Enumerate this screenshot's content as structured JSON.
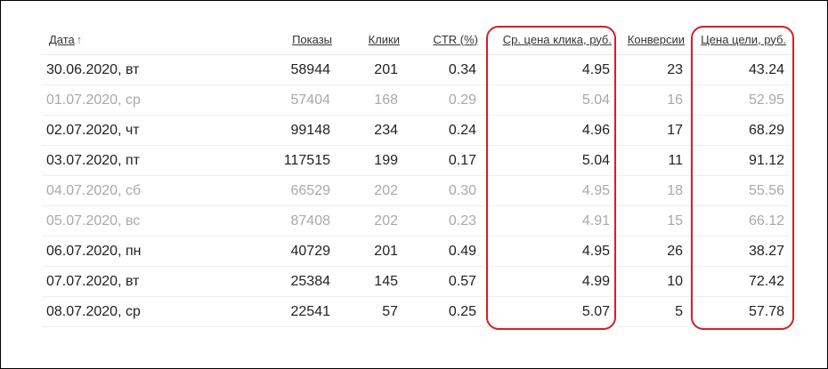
{
  "columns": [
    {
      "key": "date",
      "label": "Дата",
      "sort_arrow": "↑"
    },
    {
      "key": "impressions",
      "label": "Показы"
    },
    {
      "key": "clicks",
      "label": "Клики"
    },
    {
      "key": "ctr",
      "label": "CTR (%)"
    },
    {
      "key": "cpc",
      "label": "Ср. цена клика, руб."
    },
    {
      "key": "conversions",
      "label": "Конверсии"
    },
    {
      "key": "goal_cost",
      "label": "Цена цели, руб."
    }
  ],
  "rows": [
    {
      "date": "30.06.2020, вт",
      "impressions": "58944",
      "clicks": "201",
      "ctr": "0.34",
      "cpc": "4.95",
      "conversions": "23",
      "goal_cost": "43.24",
      "weekend": false
    },
    {
      "date": "01.07.2020, ср",
      "impressions": "57404",
      "clicks": "168",
      "ctr": "0.29",
      "cpc": "5.04",
      "conversions": "16",
      "goal_cost": "52.95",
      "weekend": true
    },
    {
      "date": "02.07.2020, чт",
      "impressions": "99148",
      "clicks": "234",
      "ctr": "0.24",
      "cpc": "4.96",
      "conversions": "17",
      "goal_cost": "68.29",
      "weekend": false
    },
    {
      "date": "03.07.2020, пт",
      "impressions": "117515",
      "clicks": "199",
      "ctr": "0.17",
      "cpc": "5.04",
      "conversions": "11",
      "goal_cost": "91.12",
      "weekend": false
    },
    {
      "date": "04.07.2020, сб",
      "impressions": "66529",
      "clicks": "202",
      "ctr": "0.30",
      "cpc": "4.95",
      "conversions": "18",
      "goal_cost": "55.56",
      "weekend": true
    },
    {
      "date": "05.07.2020, вс",
      "impressions": "87408",
      "clicks": "202",
      "ctr": "0.23",
      "cpc": "4.91",
      "conversions": "15",
      "goal_cost": "66.12",
      "weekend": true
    },
    {
      "date": "06.07.2020, пн",
      "impressions": "40729",
      "clicks": "201",
      "ctr": "0.49",
      "cpc": "4.95",
      "conversions": "26",
      "goal_cost": "38.27",
      "weekend": false
    },
    {
      "date": "07.07.2020, вт",
      "impressions": "25384",
      "clicks": "145",
      "ctr": "0.57",
      "cpc": "4.99",
      "conversions": "10",
      "goal_cost": "72.42",
      "weekend": false
    },
    {
      "date": "08.07.2020, ср",
      "impressions": "22541",
      "clicks": "57",
      "ctr": "0.25",
      "cpc": "5.07",
      "conversions": "5",
      "goal_cost": "57.78",
      "weekend": false
    }
  ],
  "colors": {
    "highlight": "#d0202a",
    "weekend_text": "#a9a9a9",
    "text": "#222222"
  }
}
